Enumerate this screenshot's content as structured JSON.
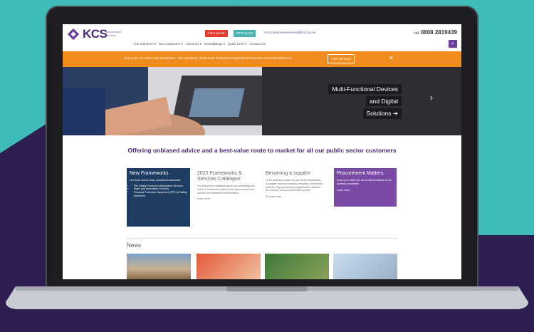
{
  "header": {
    "logo_text": "KCS",
    "logo_sub": "procurement services",
    "quote_btn": "Fleet Quote",
    "quote2_btn": "MFD Quote",
    "email": "procurementservices@kcs.org.uk",
    "phone_label": "call",
    "phone": "0808 2819439",
    "nav": [
      "Our Solutions ▾",
      "Our Customers ▾",
      "About Us ▾",
      "News&Blogs ▾",
      "Quick Links ▾",
      "Contact Us"
    ]
  },
  "banner": {
    "text": "Check out our latest new framework - Fire Solutions, Work Zone Protective Equipment (PPE) and Associated Services",
    "button": "Find out more",
    "close": "✕"
  },
  "hero": {
    "caption_1": "Multi-Functional Devices",
    "caption_2": "and Digital",
    "caption_3": "Solutions",
    "arrow": "›"
  },
  "tagline": "Offering unbiased advice and a best-value route to market for all our public sector customers",
  "cards": {
    "c1": {
      "title": "New Frameworks",
      "intro": "Our most recent newly launched frameworks:",
      "items": [
        "Fire Safety Products & Associated Services",
        "Signs and Associated Services",
        "Personal Protective Equipment (PPE) & Safety Workwear"
      ]
    },
    "c2": {
      "title": "2022 Frameworks & Services Catalogue",
      "body": "Our brand new catalogue gives you everything you need to understand public sector procurement and access our frameworks and services.",
      "more": "Learn more"
    },
    "c3": {
      "title": "Becoming a supplier",
      "body": "To be awarded a place on one of our frameworks, a supplier must successfully complete a full tender process. High-performing suppliers are critical to the success of our procurement service.",
      "more": "Find out more"
    },
    "c4": {
      "title": "Procurement Matters",
      "body": "Keep up to date with all our latest editions of our quarterly newsletter",
      "more": "Learn more"
    }
  },
  "news": {
    "title": "News"
  },
  "colors": {
    "brand_purple": "#4b2a7a",
    "banner_orange": "#f08b1d",
    "card_navy": "#1f3d63",
    "card_purple": "#7b4aa6"
  }
}
